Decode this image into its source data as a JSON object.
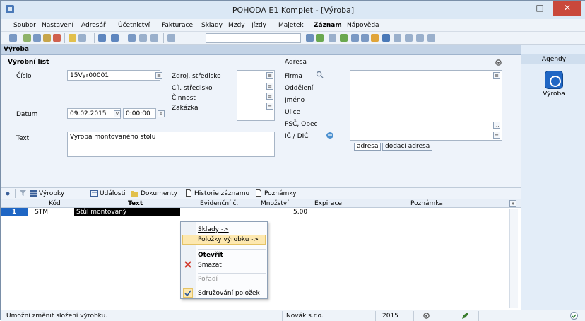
{
  "window": {
    "title": "POHODA E1 Komplet - [Výroba]",
    "minimize": "–",
    "maximize": "□",
    "close": "✕"
  },
  "menu": {
    "items": [
      "Soubor",
      "Nastavení",
      "Adresář",
      "Účetnictví",
      "Fakturace",
      "Sklady",
      "Mzdy",
      "Jízdy",
      "Majetek",
      "Záznam",
      "Nápověda"
    ],
    "bold_index": 9
  },
  "header": {
    "title": "Výroba"
  },
  "form": {
    "section_title": "Výrobní list",
    "cislo_label": "Číslo",
    "cislo_value": "15Vyr00001",
    "datum_label": "Datum",
    "datum_value": "09.02.2015",
    "time_value": "0:00:00",
    "text_label": "Text",
    "text_value": "Výroba montovaného stolu",
    "zdroj_label": "Zdroj. středisko",
    "cil_label": "Cíl. středisko",
    "cinnost_label": "Činnost",
    "zakazka_label": "Zakázka",
    "adresa_label": "Adresa",
    "firma_label": "Firma",
    "oddeleni_label": "Oddělení",
    "jmeno_label": "Jméno",
    "ulice_label": "Ulice",
    "psc_label": "PSČ, Obec",
    "ic_label": "IČ / DIČ",
    "addr_tab1": "adresa",
    "addr_tab2": "dodací adresa"
  },
  "tabs": {
    "items": [
      "Výrobky",
      "Události",
      "Dokumenty",
      "Historie záznamu",
      "Poznámky"
    ]
  },
  "grid": {
    "columns": [
      "Kód",
      "Text",
      "Evidenční č.",
      "Množství",
      "Expirace",
      "Poznámka"
    ],
    "rows": [
      {
        "num": "1",
        "kod": "STM",
        "text": "Stůl montovaný",
        "evid": "",
        "mnozstvi": "5,00",
        "expirace": "",
        "poznamka": ""
      }
    ]
  },
  "context_menu": {
    "items": [
      "Sklady ->",
      "Položky výrobku ->",
      "Otevřít",
      "Smazat",
      "Pořadí",
      "Sdružování položek"
    ],
    "selected": "Položky výrobku ->"
  },
  "sidebar": {
    "title": "Agendy",
    "item_label": "Výroba"
  },
  "status": {
    "message": "Umožní změnit složení výrobku.",
    "company": "Novák s.r.o.",
    "year": "2015"
  },
  "colors": {
    "accent": "#1f66c4",
    "selection": "#fde8b0",
    "close": "#c9483b"
  }
}
